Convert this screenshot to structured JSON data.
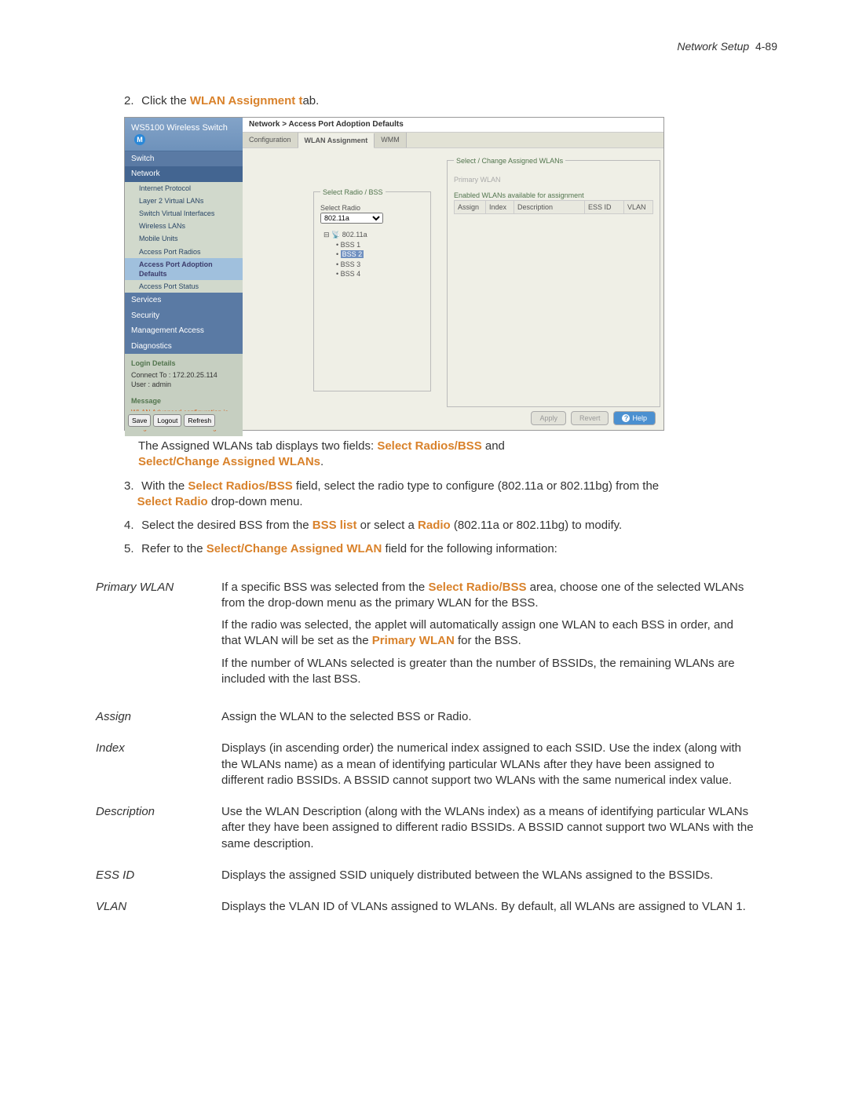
{
  "header": {
    "section": "Network Setup",
    "page": "4-89"
  },
  "steps": {
    "s2": {
      "num": "2.",
      "pre": "Click the ",
      "bold": "WLAN Assignment t",
      "post": "ab."
    },
    "s3": {
      "num": "3.",
      "pre": "With the ",
      "bold1": "Select Radios/BSS",
      "mid": " field, select the radio type to configure (802.11a or 802.11bg) from the ",
      "bold2": "Select Radio",
      "post": " drop-down menu."
    },
    "s4": {
      "num": "4.",
      "pre": "Select the desired BSS from the ",
      "bold1": "BSS list",
      "mid": " or select a ",
      "bold2": "Radio",
      "post": " (802.11a or 802.11bg) to modify."
    },
    "s5": {
      "num": "5.",
      "pre": "Refer to the ",
      "bold": "Select/Change Assigned WLAN",
      "post": " field for the following information:"
    }
  },
  "intro": {
    "pre": "The Assigned WLANs tab displays two fields: ",
    "bold1": "Select Radios/BSS",
    "and": " and ",
    "bold2": "Select/Change Assigned WLANs",
    "post": "."
  },
  "screenshot": {
    "title": "WS5100 Wireless Switch",
    "nav": {
      "switch": "Switch",
      "network": "Network",
      "items": {
        "ip": "Internet Protocol",
        "l2": "Layer 2 Virtual LANs",
        "svi": "Switch Virtual Interfaces",
        "wlans": "Wireless LANs",
        "mu": "Mobile Units",
        "apr": "Access Port Radios",
        "apad": "Access Port Adoption Defaults",
        "aps": "Access Port Status"
      },
      "services": "Services",
      "security": "Security",
      "mgmt": "Management Access",
      "diag": "Diagnostics"
    },
    "login": {
      "title": "Login Details",
      "connect_lbl": "Connect To :",
      "connect_val": "172.20.25.114",
      "user_lbl": "User :",
      "user_val": "admin",
      "message_title": "Message",
      "warn": "WLAN Advanced configuration is not enabled. The Radio-WLAN assignment cannot be changed"
    },
    "bottom_btns": {
      "save": "Save",
      "logout": "Logout",
      "refresh": "Refresh"
    },
    "breadcrumb": "Network > Access Port Adoption Defaults",
    "tabs": {
      "config": "Configuration",
      "wlan": "WLAN Assignment",
      "wmm": "WMM"
    },
    "left_panel": {
      "legend": "Select Radio / BSS",
      "select_label": "Select Radio",
      "select_value": "802.11a",
      "tree_root": "802.11a",
      "bss": [
        "BSS 1",
        "BSS 2",
        "BSS 3",
        "BSS 4"
      ]
    },
    "right_panel": {
      "legend": "Select / Change Assigned WLANs",
      "primary": "Primary WLAN",
      "enabled": "Enabled WLANs available for assignment",
      "cols": {
        "assign": "Assign",
        "index": "Index",
        "desc": "Description",
        "essid": "ESS ID",
        "vlan": "VLAN"
      }
    },
    "actions": {
      "apply": "Apply",
      "revert": "Revert",
      "help": "Help"
    }
  },
  "defs": {
    "primary": {
      "term": "Primary WLAN",
      "p1a": "If a specific BSS was selected from the ",
      "p1b": "Select Radio/BSS",
      "p1c": " area, choose one of the selected WLANs from the drop-down menu as the primary WLAN for the BSS.",
      "p2a": "If the radio was selected, the applet will automatically assign one WLAN to each BSS in order, and that WLAN will be set as the ",
      "p2b": "Primary WLAN",
      "p2c": " for the BSS.",
      "p3": "If the number of WLANs selected is greater than the number of BSSIDs, the remaining WLANs are included with the last BSS."
    },
    "assign": {
      "term": "Assign",
      "d": "Assign the WLAN to the selected BSS or Radio."
    },
    "index": {
      "term": "Index",
      "d": "Displays (in ascending order) the numerical index assigned to each SSID. Use the index (along with the WLANs name) as a mean of identifying particular WLANs after they have been assigned to different radio BSSIDs. A BSSID cannot support two WLANs with the same numerical index value."
    },
    "desc": {
      "term": "Description",
      "d": "Use the WLAN Description (along with the WLANs index) as a means of identifying particular WLANs after they have been assigned to different radio BSSIDs. A BSSID cannot support two WLANs with the same description."
    },
    "essid": {
      "term": "ESS ID",
      "d": "Displays the assigned SSID uniquely distributed between the WLANs assigned to the BSSIDs."
    },
    "vlan": {
      "term": "VLAN",
      "d": "Displays the VLAN ID of VLANs assigned to WLANs. By default, all WLANs are assigned to VLAN 1."
    }
  }
}
